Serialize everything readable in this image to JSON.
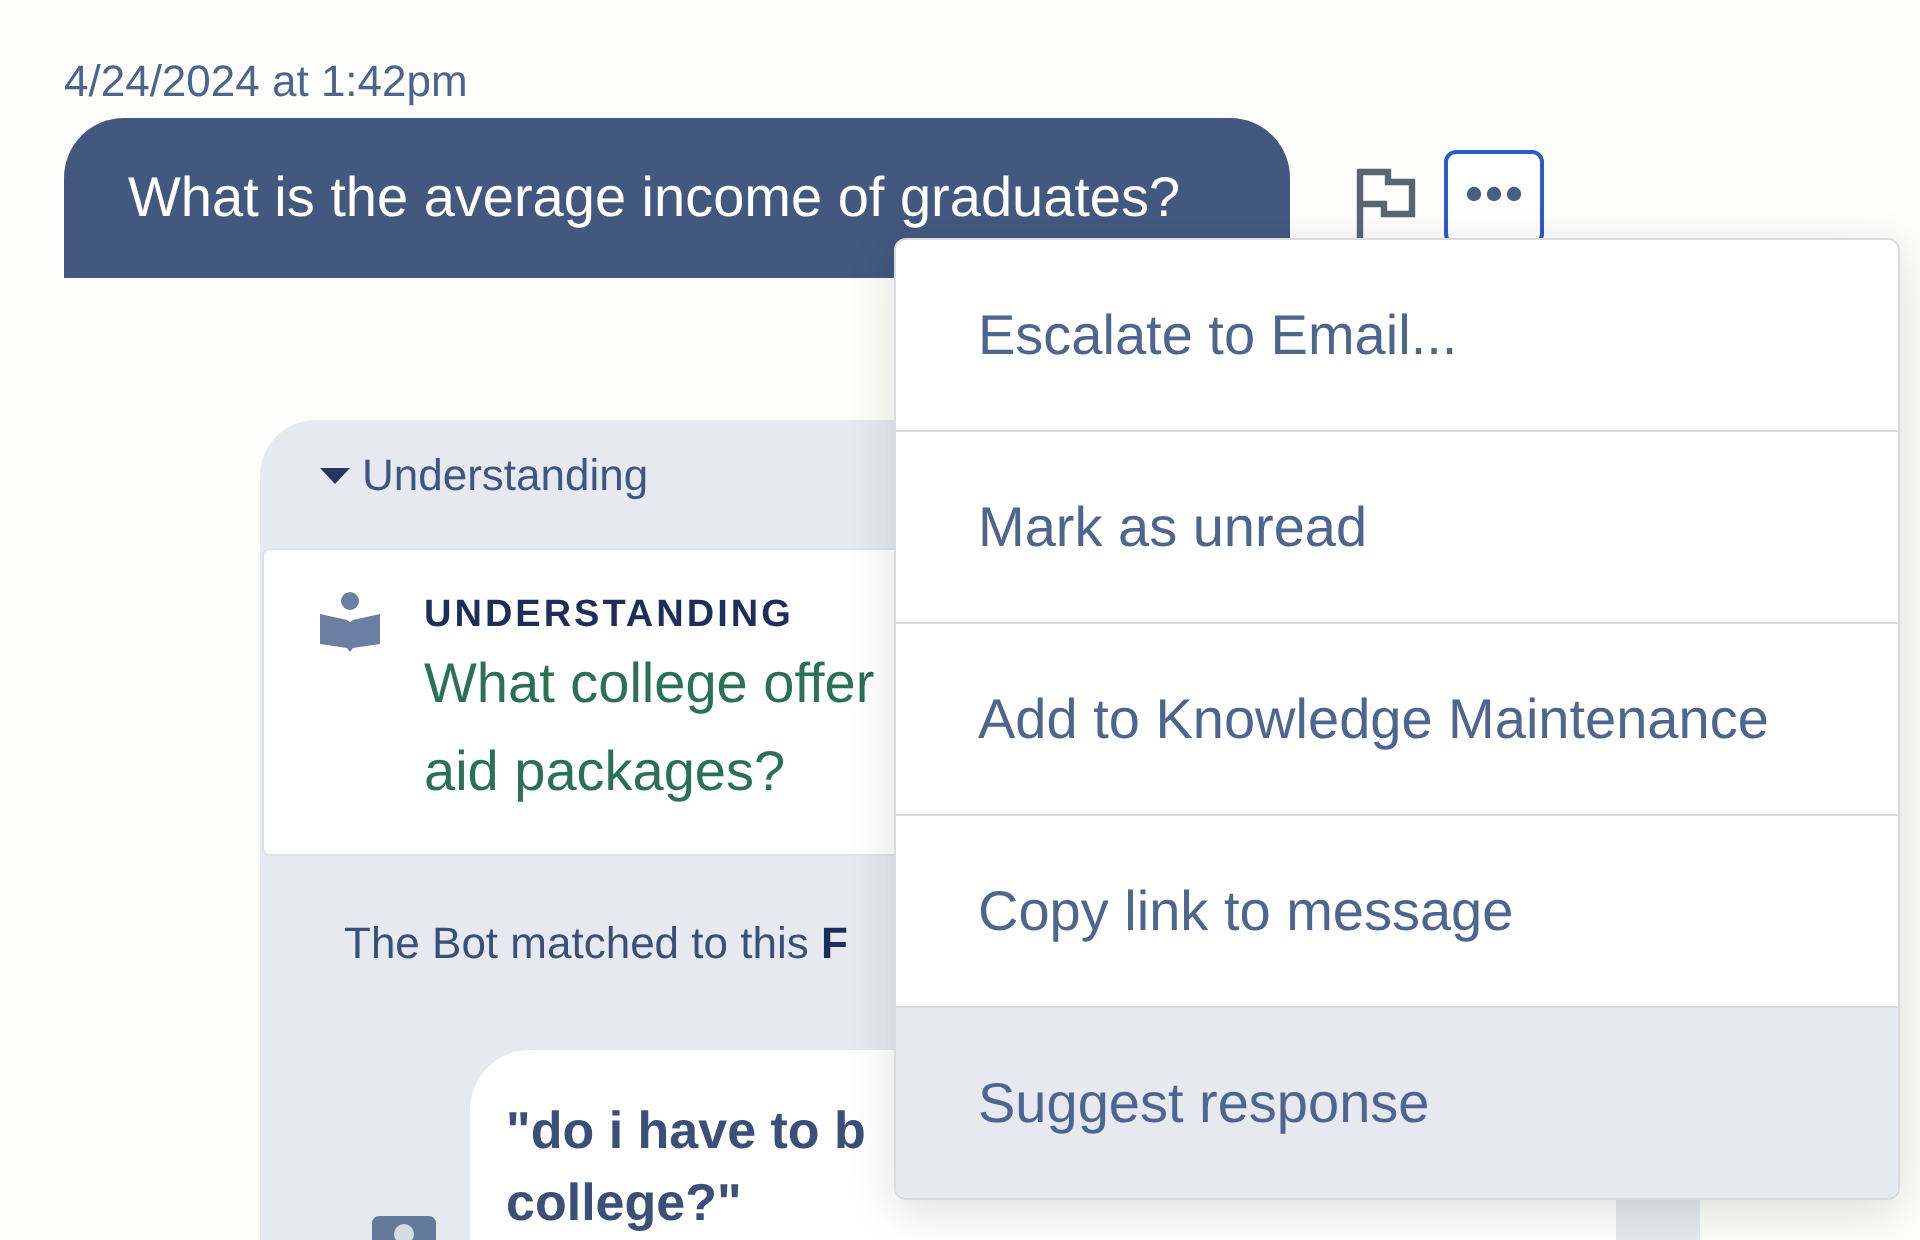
{
  "timestamp": "4/24/2024 at 1:42pm",
  "message": {
    "text": "What is the average income of graduates?"
  },
  "message_actions": [
    {
      "kind": "flag",
      "focused": false
    },
    {
      "kind": "more",
      "focused": true
    }
  ],
  "understanding_panel": {
    "title": "Understanding",
    "expanded": true,
    "card": {
      "label": "UNDERSTANDING",
      "text_lines": [
        "What college offer",
        "aid packages?"
      ]
    },
    "match_note": "The Bot matched to this **F**",
    "matched_question": {
      "text_lines": [
        "\"do i have to b",
        "college?\""
      ]
    }
  },
  "menu": {
    "items": [
      {
        "label": "Escalate to Email...",
        "highlighted": false
      },
      {
        "label": "Mark as unread",
        "highlighted": false
      },
      {
        "label": "Add to Knowledge Maintenance",
        "highlighted": false
      },
      {
        "label": "Copy link to message",
        "highlighted": false
      },
      {
        "label": "Suggest response",
        "highlighted": true
      }
    ]
  }
}
